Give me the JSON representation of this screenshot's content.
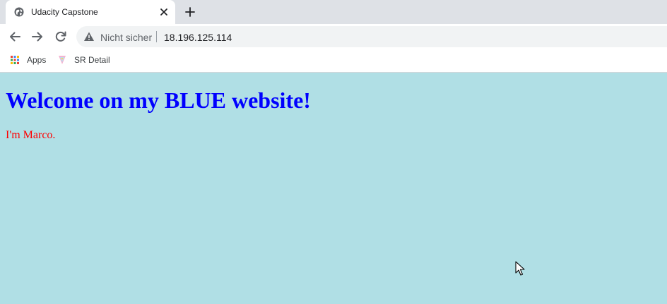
{
  "browser": {
    "tab": {
      "title": "Udacity Capstone",
      "icon": "globe-icon"
    },
    "new_tab_icon": "plus-icon",
    "address_bar": {
      "security_icon": "warning-icon",
      "security_label": "Nicht sicher",
      "url": "18.196.125.114"
    },
    "bookmarks": [
      {
        "label": "Apps",
        "icon": "apps-grid-icon"
      },
      {
        "label": "SR Detail",
        "icon": "bookmark-favicon-icon"
      }
    ]
  },
  "page": {
    "background_color": "#b0dfe5",
    "heading": "Welcome on my BLUE website!",
    "heading_color": "#0000ff",
    "paragraph": "I'm Marco.",
    "paragraph_color": "#ff0000"
  }
}
